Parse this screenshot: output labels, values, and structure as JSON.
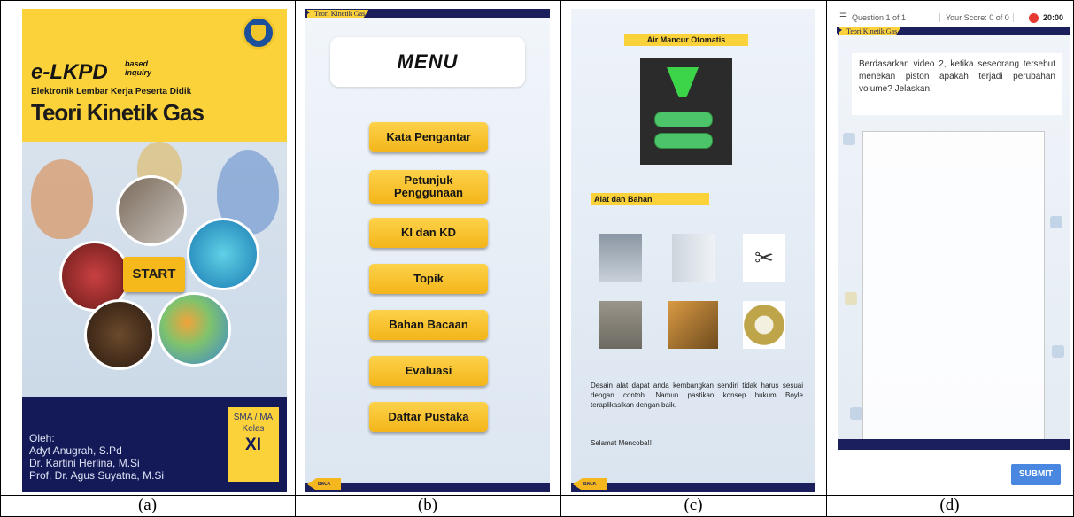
{
  "captions": [
    "(a)",
    "(b)",
    "(c)",
    "(d)"
  ],
  "panel_a": {
    "brand": "e-LKPD",
    "brand_side_1": "based",
    "brand_side_2": "inquiry",
    "subtitle": "Elektronik Lembar Kerja Peserta Didik",
    "title": "Teori Kinetik Gas",
    "start_label": "START",
    "authors_heading": "Oleh:",
    "authors": [
      "Adyt Anugrah, S.Pd",
      "Dr. Kartini Herlina, M.Si",
      "Prof. Dr. Agus Suyatna, M.Si"
    ],
    "grade_school": "SMA / MA",
    "grade_label": "Kelas",
    "grade_value": "XI"
  },
  "panel_b": {
    "tag": "Teori Kinetik Gas",
    "menu_title": "MENU",
    "items": [
      "Kata Pengantar",
      "Petunjuk Penggunaan",
      "KI dan KD",
      "Topik",
      "Bahan Bacaan",
      "Evaluasi",
      "Daftar Pustaka"
    ],
    "back_label": "BACK"
  },
  "panel_c": {
    "heading": "Air Mancur Otomatis",
    "materials_label": "Alat dan Bahan",
    "body": "Desain alat dapat anda kembangkan sendiri tidak harus sesuai dengan contoh. Namun pastikan konsep hukum Boyle teraplikasikan dengan baik.",
    "closing": "Selamat Mencoba!!",
    "back_label": "BACK"
  },
  "panel_d": {
    "question_label": "Question 1 of 1",
    "score_label": "Your Score: 0 of 0",
    "timer": "20:00",
    "tag": "Teori Kinetik Gas",
    "question_text": "Berdasarkan video 2, ketika seseorang tersebut menekan piston apakah terjadi perubahan volume? Jelaskan!",
    "submit_label": "SUBMIT"
  }
}
